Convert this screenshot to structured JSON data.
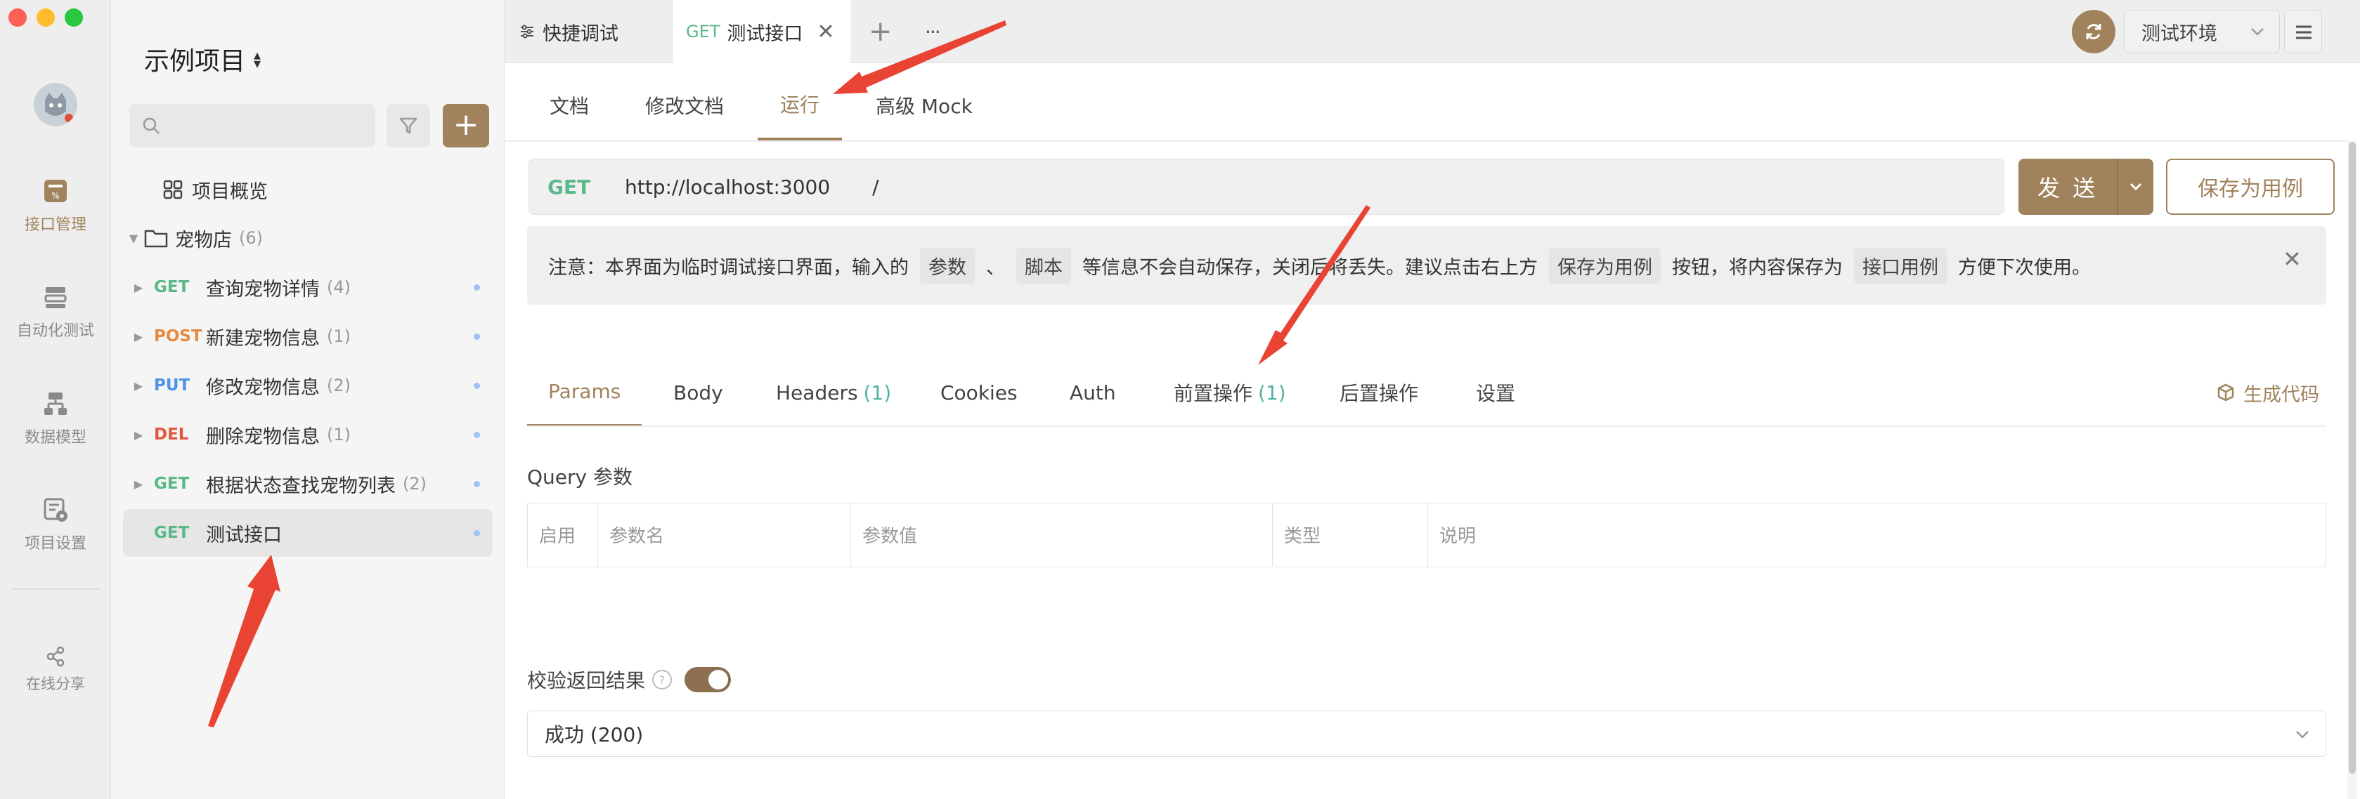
{
  "app": {
    "project_title": "示例项目",
    "brand_color": "#a0835c"
  },
  "rail": {
    "items": [
      {
        "label": "接口管理",
        "icon": "api-management-icon",
        "active": true
      },
      {
        "label": "自动化测试",
        "icon": "automation-test-icon",
        "active": false
      },
      {
        "label": "数据模型",
        "icon": "data-model-icon",
        "active": false
      },
      {
        "label": "项目设置",
        "icon": "project-settings-icon",
        "active": false
      }
    ],
    "share_label": "在线分享"
  },
  "sidebar": {
    "search_placeholder": "",
    "overview_label": "项目概览",
    "folder": {
      "name": "宠物店",
      "count": "(6)"
    },
    "items": [
      {
        "method": "GET",
        "name": "查询宠物详情",
        "count": "(4)"
      },
      {
        "method": "POST",
        "name": "新建宠物信息",
        "count": "(1)"
      },
      {
        "method": "PUT",
        "name": "修改宠物信息",
        "count": "(2)"
      },
      {
        "method": "DEL",
        "name": "删除宠物信息",
        "count": "(1)"
      },
      {
        "method": "GET",
        "name": "根据状态查找宠物列表",
        "count": "(2)"
      }
    ],
    "selected": {
      "method": "GET",
      "name": "测试接口"
    }
  },
  "tabs": {
    "quick_debug": "快捷调试",
    "active_method": "GET",
    "active_name": "测试接口",
    "more": "···",
    "add": "+"
  },
  "env": {
    "label": "测试环境"
  },
  "sub_tabs": [
    "文档",
    "修改文档",
    "运行",
    "高级 Mock"
  ],
  "url_bar": {
    "method": "GET",
    "host": "http://localhost:3000",
    "path": "/",
    "send_label": "发 送",
    "save_case_label": "保存为用例"
  },
  "notice": {
    "prefix": "注意：本界面为临时调试接口界面，输入的",
    "chip1": "参数",
    "sep": "、",
    "chip2": "脚本",
    "middle": "等信息不会自动保存，关闭后将丢失。建议点击右上方",
    "chip3": "保存为用例",
    "middle2": "按钮，将内容保存为",
    "chip4": "接口用例",
    "suffix": "方便下次使用。"
  },
  "request_tabs": [
    {
      "label": "Params",
      "count": ""
    },
    {
      "label": "Body",
      "count": ""
    },
    {
      "label": "Headers",
      "count": "(1)"
    },
    {
      "label": "Cookies",
      "count": ""
    },
    {
      "label": "Auth",
      "count": ""
    },
    {
      "label": "前置操作",
      "count": "(1)"
    },
    {
      "label": "后置操作",
      "count": ""
    },
    {
      "label": "设置",
      "count": ""
    }
  ],
  "generate_code": "生成代码",
  "query": {
    "title": "Query 参数",
    "columns": [
      "启用",
      "参数名",
      "参数值",
      "类型",
      "说明"
    ]
  },
  "validate": {
    "label": "校验返回结果",
    "enabled": true,
    "selected_response": "成功 (200)"
  }
}
